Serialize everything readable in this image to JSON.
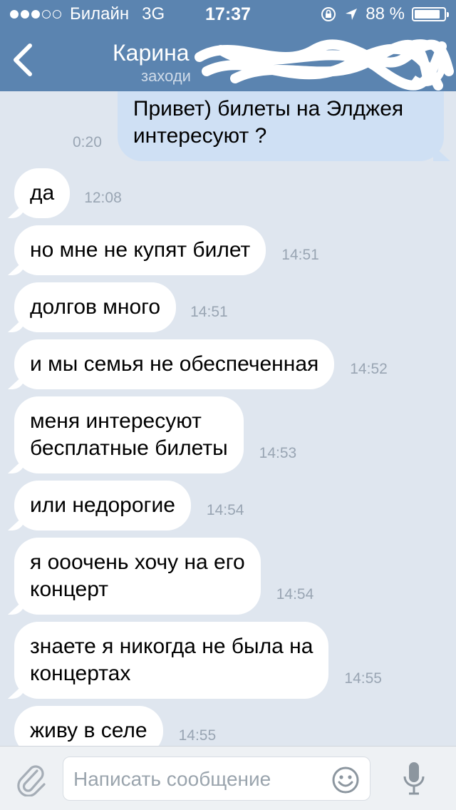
{
  "status_bar": {
    "carrier": "Билайн",
    "network": "3G",
    "time": "17:37",
    "battery_percent": "88 %",
    "battery_level": 0.88,
    "signal_bars_filled": 3,
    "signal_bars_total": 5
  },
  "header": {
    "title": "Карина",
    "subtitle": "заходи",
    "back_icon": "chevron-left-icon"
  },
  "messages": [
    {
      "id": "m0",
      "direction": "out",
      "text": "Привет) билеты на Элджея\nинтересуют ?",
      "time": "0:20"
    },
    {
      "id": "m1",
      "direction": "in",
      "text": "да",
      "time": "12:08"
    },
    {
      "id": "m2",
      "direction": "in",
      "text": "но мне не купят билет",
      "time": "14:51"
    },
    {
      "id": "m3",
      "direction": "in",
      "text": "долгов много",
      "time": "14:51"
    },
    {
      "id": "m4",
      "direction": "in",
      "text": "и мы семья не обеспеченная",
      "time": "14:52"
    },
    {
      "id": "m5",
      "direction": "in",
      "text": "меня интересуют\nбесплатные билеты",
      "time": "14:53"
    },
    {
      "id": "m6",
      "direction": "in",
      "text": "или недорогие",
      "time": "14:54"
    },
    {
      "id": "m7",
      "direction": "in",
      "text": "я ооочень хочу на его\nконцерт",
      "time": "14:54"
    },
    {
      "id": "m8",
      "direction": "in",
      "text": "знаете я никогда не была на\nконцертах",
      "time": "14:55"
    },
    {
      "id": "m9",
      "direction": "in",
      "text": "живу в селе",
      "time": "14:55"
    }
  ],
  "composer": {
    "placeholder": "Написать сообщение",
    "value": "",
    "attach_icon": "paperclip-icon",
    "emoji_icon": "emoji-icon",
    "mic_icon": "microphone-icon"
  },
  "colors": {
    "header_bg": "#5b84b0",
    "chat_bg": "#dfe6ef",
    "incoming_bubble": "#ffffff",
    "outgoing_bubble": "#cfe0f4",
    "timestamp": "#99a5b3"
  }
}
